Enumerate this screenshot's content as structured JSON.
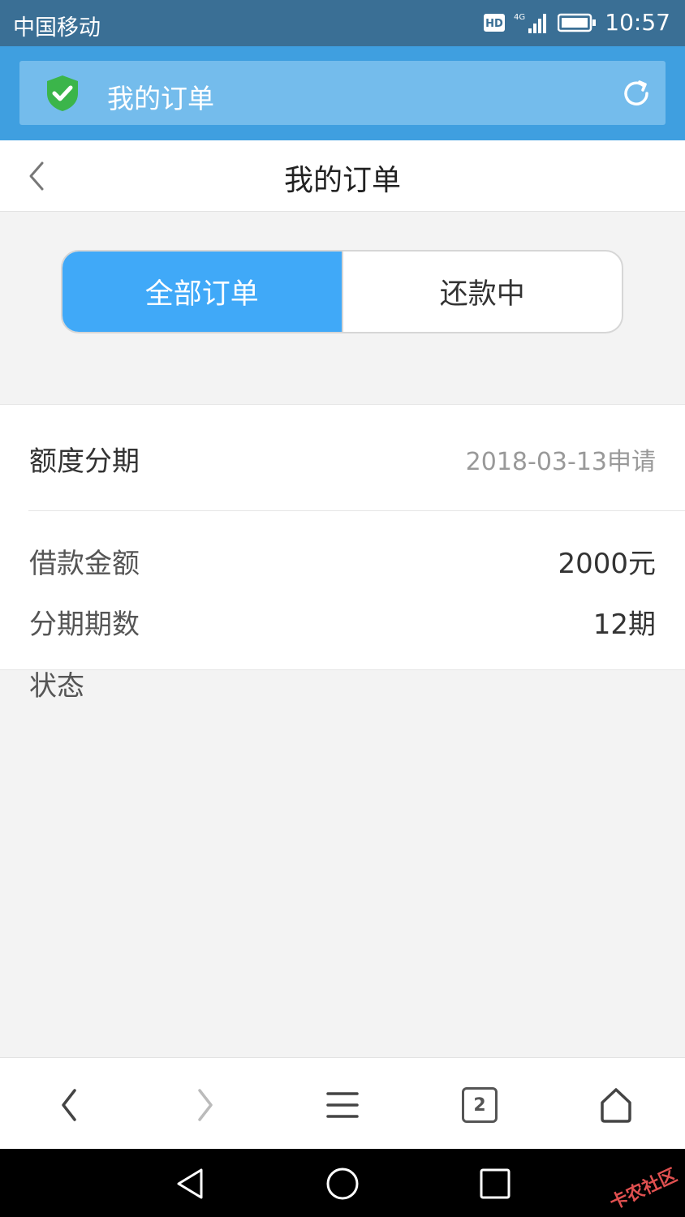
{
  "status_bar": {
    "carrier": "中国移动",
    "hd_badge": "HD",
    "network": "4G",
    "time": "10:57"
  },
  "browser": {
    "url_title": "我的订单",
    "tab_count": "2"
  },
  "page": {
    "title": "我的订单"
  },
  "tabs": [
    {
      "label": "全部订单",
      "active": true
    },
    {
      "label": "还款中",
      "active": false
    }
  ],
  "order": {
    "type": "额度分期",
    "date": "2018-03-13申请",
    "loan_amount_label": "借款金额",
    "loan_amount_value": "2000元",
    "periods_label": "分期期数",
    "periods_value": "12期",
    "status_label": "状态"
  },
  "watermark": "卡农社区",
  "colors": {
    "status_bar_bg": "#3a6f95",
    "browser_bar_bg": "#3f9fe0",
    "url_box_bg": "#74bcec",
    "active_tab": "#40a9f8",
    "shield_green": "#3bb54a"
  }
}
